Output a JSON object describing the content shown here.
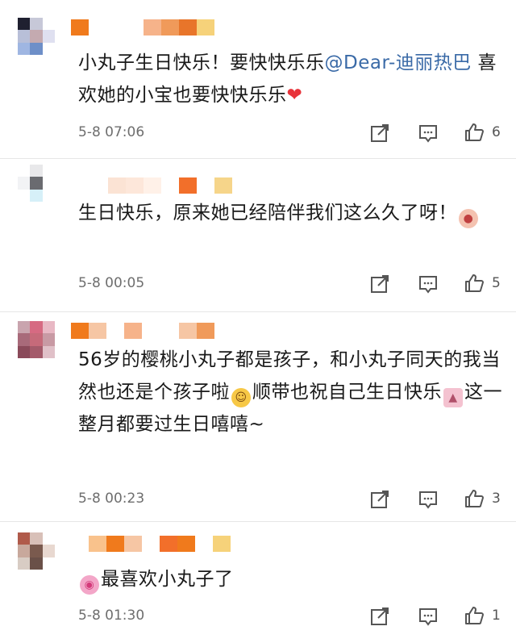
{
  "comments": [
    {
      "text_parts": [
        "小丸子生日快乐！要快快乐乐",
        "@Dear-迪丽热巴",
        " 喜欢她的小宝也要快快乐乐"
      ],
      "time": "5-8 07:06",
      "likes": "6"
    },
    {
      "text_parts": [
        "生日快乐，原来她已经陪伴我们这么久了呀！"
      ],
      "time": "5-8 00:05",
      "likes": "5"
    },
    {
      "text_parts": [
        "56岁的樱桃小丸子都是孩子，和小丸子同天的我当然也还是个孩子啦",
        "顺带也祝自己生日快乐",
        "这一整月都要过生日嘻嘻~"
      ],
      "time": "5-8 00:23",
      "likes": "3"
    },
    {
      "text_parts": [
        "最喜欢小丸子了"
      ],
      "time": "5-8 01:30",
      "likes": "1"
    }
  ],
  "icons": {
    "share": "share-icon",
    "comment": "comment-icon",
    "like": "thumbs-up-icon"
  },
  "colors": {
    "mention": "#3a6aa7",
    "text": "#1a1a1a",
    "meta": "#6e6e6e",
    "heart": "#e8333a"
  }
}
